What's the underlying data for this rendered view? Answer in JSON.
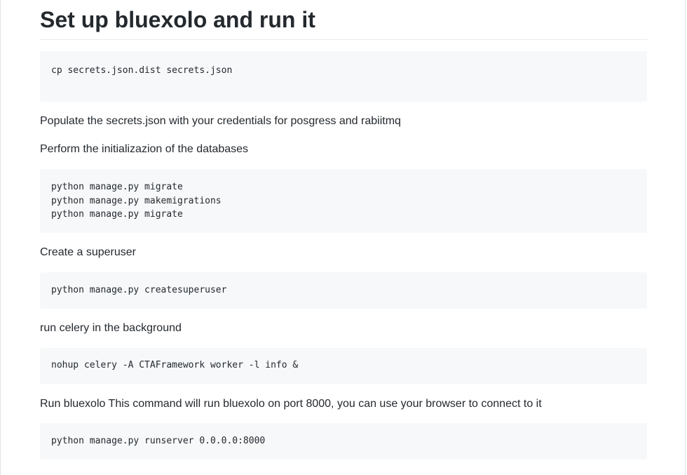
{
  "title": "Set up bluexolo and run it",
  "code_copy_secrets": "cp secrets.json.dist secrets.json",
  "text_populate": "Populate the secrets.json with your credentials for posgress and rabiitmq",
  "text_init": "Perform the initializazion of the databases",
  "code_migrations": "python manage.py migrate\npython manage.py makemigrations\npython manage.py migrate",
  "text_superuser": "Create a superuser",
  "code_superuser": "python manage.py createsuperuser",
  "text_celery": "run celery in the background",
  "code_celery": "nohup celery -A CTAFramework worker -l info &",
  "text_run": "Run bluexolo This command will run bluexolo on port 8000, you can use your browser to connect to it",
  "code_runserver": "python manage.py runserver 0.0.0.0:8000"
}
